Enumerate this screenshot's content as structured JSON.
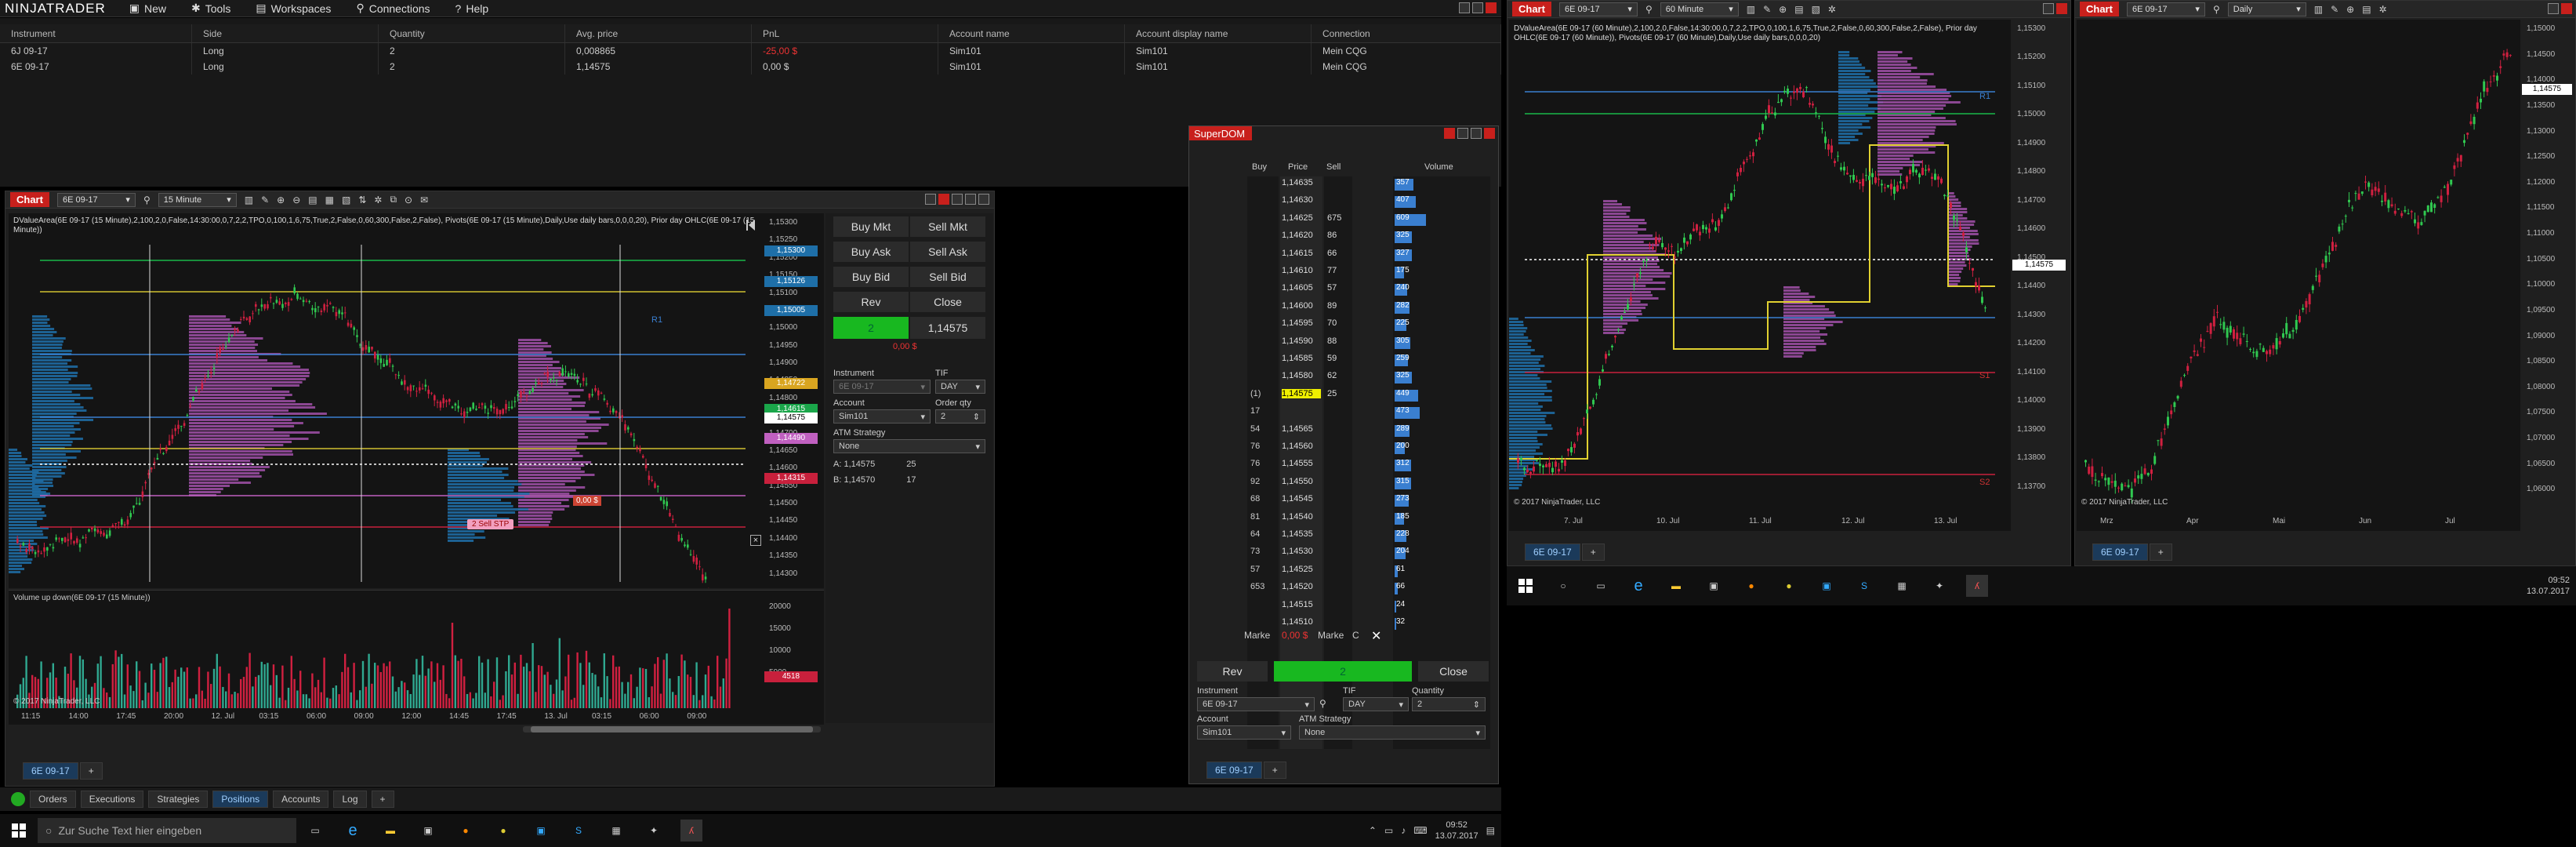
{
  "app": {
    "logo": "NINJATRADER",
    "menu": [
      "New",
      "Tools",
      "Workspaces",
      "Connections",
      "Help"
    ]
  },
  "positions": {
    "columns": [
      "Instrument",
      "Side",
      "Quantity",
      "Avg. price",
      "PnL",
      "Account name",
      "Account display name",
      "Connection"
    ],
    "rows": [
      [
        "6J 09-17",
        "Long",
        "2",
        "0,008865",
        "-25,00 $",
        "Sim101",
        "Sim101",
        "Mein CQG"
      ],
      [
        "6E 09-17",
        "Long",
        "2",
        "1,14575",
        "0,00 $",
        "Sim101",
        "Sim101",
        "Mein CQG"
      ]
    ]
  },
  "chart1": {
    "title": "Chart",
    "instrument": "6E 09-17",
    "interval": "15 Minute",
    "indicator_text": "DValueArea(6E 09-17 (15 Minute),2,100,2,0,False,14:30:00,0,7,2,2,TPO,0,100,1,6,75,True,2,False,0,60,300,False,2,False), Pivots(6E 09-17 (15 Minute),Daily,Use daily bars,0,0,0,20), Prior day OHLC(6E 09-17 (15 Minute))",
    "volume_label": "Volume up down(6E 09-17 (15 Minute))",
    "copyright": "© 2017 NinjaTrader, LLC",
    "price_ticks": [
      "1,15300",
      "1,15250",
      "1,15200",
      "1,15150",
      "1,15100",
      "1,15050",
      "1,15000",
      "1,14950",
      "1,14900",
      "1,14850",
      "1,14800",
      "1,14750",
      "1,14700",
      "1,14650",
      "1,14600",
      "1,14550",
      "1,14500",
      "1,14450",
      "1,14400",
      "1,14350",
      "1,14300"
    ],
    "price_boxes": [
      {
        "text": "1,15300",
        "color": "#1e6fa8"
      },
      {
        "text": "1,15126",
        "color": "#1e6fa8"
      },
      {
        "text": "1,15005",
        "color": "#1e6fa8"
      },
      {
        "text": "1,14722",
        "color": "#d9a520"
      },
      {
        "text": "1,14615",
        "color": "#1aa64a"
      },
      {
        "text": "1,14575",
        "color": "#ffffff"
      },
      {
        "text": "1,14490",
        "color": "#c060c0"
      },
      {
        "text": "1,14315",
        "color": "#c8203c"
      }
    ],
    "vol_ticks": [
      "20000",
      "15000",
      "10000",
      "5000"
    ],
    "vol_box": "4518",
    "time_ticks": [
      "11:15",
      "14:00",
      "17:45",
      "20:00",
      "12. Jul",
      "03:15",
      "06:00",
      "09:00",
      "12:00",
      "14:45",
      "17:45",
      "13. Jul",
      "03:15",
      "06:00",
      "09:00"
    ],
    "r1": "R1",
    "order_marker": "2 Sell STP",
    "order_marker2": "0,00 $",
    "chart_trader": {
      "buy_mkt": "Buy Mkt",
      "sell_mkt": "Sell Mkt",
      "buy_ask": "Buy Ask",
      "sell_ask": "Sell Ask",
      "buy_bid": "Buy Bid",
      "sell_bid": "Sell Bid",
      "rev": "Rev",
      "close": "Close",
      "position_qty": "2",
      "position_price": "1,14575",
      "pnl": "0,00 $",
      "instrument_label": "Instrument",
      "instrument_value": "6E 09-17",
      "tif_label": "TIF",
      "tif_value": "DAY",
      "account_label": "Account",
      "account_value": "Sim101",
      "orderqty_label": "Order qty",
      "orderqty_value": "2",
      "atm_label": "ATM Strategy",
      "atm_value": "None",
      "ask_label": "A:",
      "ask_price": "1,14575",
      "ask_size": "25",
      "bid_label": "B:",
      "bid_price": "1,14570",
      "bid_size": "17"
    },
    "tab": "6E 09-17"
  },
  "superdom": {
    "title": "SuperDOM",
    "headers": {
      "buy": "Buy",
      "price": "Price",
      "sell": "Sell",
      "volume": "Volume"
    },
    "rows": [
      {
        "buy": "",
        "price": "1,14635",
        "sell": "",
        "vol": "357"
      },
      {
        "buy": "",
        "price": "1,14630",
        "sell": "",
        "vol": "407"
      },
      {
        "buy": "",
        "price": "1,14625",
        "sell": "675",
        "vol": "609"
      },
      {
        "buy": "",
        "price": "1,14620",
        "sell": "86",
        "vol": "325"
      },
      {
        "buy": "",
        "price": "1,14615",
        "sell": "66",
        "vol": "327"
      },
      {
        "buy": "",
        "price": "1,14610",
        "sell": "77",
        "vol": "175"
      },
      {
        "buy": "",
        "price": "1,14605",
        "sell": "57",
        "vol": "240"
      },
      {
        "buy": "",
        "price": "1,14600",
        "sell": "89",
        "vol": "282"
      },
      {
        "buy": "",
        "price": "1,14595",
        "sell": "70",
        "vol": "225"
      },
      {
        "buy": "",
        "price": "1,14590",
        "sell": "88",
        "vol": "305"
      },
      {
        "buy": "",
        "price": "1,14585",
        "sell": "59",
        "vol": "259"
      },
      {
        "buy": "",
        "price": "1,14580",
        "sell": "62",
        "vol": "325"
      },
      {
        "buy": "(1)",
        "price": "1,14575",
        "sell": "25",
        "vol": "449"
      },
      {
        "buy": "17",
        "price": "",
        "sell": "",
        "vol": "473"
      },
      {
        "buy": "54",
        "price": "1,14565",
        "sell": "",
        "vol": "289"
      },
      {
        "buy": "76",
        "price": "1,14560",
        "sell": "",
        "vol": "200"
      },
      {
        "buy": "76",
        "price": "1,14555",
        "sell": "",
        "vol": "312"
      },
      {
        "buy": "92",
        "price": "1,14550",
        "sell": "",
        "vol": "315"
      },
      {
        "buy": "68",
        "price": "1,14545",
        "sell": "",
        "vol": "273"
      },
      {
        "buy": "81",
        "price": "1,14540",
        "sell": "",
        "vol": "185"
      },
      {
        "buy": "64",
        "price": "1,14535",
        "sell": "",
        "vol": "228"
      },
      {
        "buy": "73",
        "price": "1,14530",
        "sell": "",
        "vol": "204"
      },
      {
        "buy": "57",
        "price": "1,14525",
        "sell": "",
        "vol": "61"
      },
      {
        "buy": "653",
        "price": "1,14520",
        "sell": "",
        "vol": "66"
      },
      {
        "buy": "",
        "price": "1,14515",
        "sell": "",
        "vol": "24"
      },
      {
        "buy": "",
        "price": "1,14510",
        "sell": "",
        "vol": "32"
      }
    ],
    "market_left": "Marke",
    "market_pnl": "0,00 $",
    "market_right": "Marke",
    "c": "C",
    "rev": "Rev",
    "qty": "2",
    "close": "Close",
    "instrument_label": "Instrument",
    "instrument_value": "6E 09-17",
    "tif_label": "TIF",
    "tif_value": "DAY",
    "quantity_label": "Quantity",
    "quantity_value": "2",
    "account_label": "Account",
    "account_value": "Sim101",
    "atm_label": "ATM Strategy",
    "atm_value": "None",
    "tab": "6E 09-17"
  },
  "bottom_tabs": [
    "Orders",
    "Executions",
    "Strategies",
    "Positions",
    "Accounts",
    "Log"
  ],
  "chart2": {
    "title": "Chart",
    "instrument": "6E 09-17",
    "interval": "60 Minute",
    "indicator_text": "DValueArea(6E 09-17 (60 Minute),2,100,2,0,False,14:30:00,0,7,2,2,TPO,0,100,1,6,75,True,2,False,0,60,300,False,2,False), Prior day OHLC(6E 09-17 (60 Minute)), Pivots(6E 09-17 (60 Minute),Daily,Use daily bars,0,0,0,20)",
    "copyright": "© 2017 NinjaTrader, LLC",
    "price_ticks": [
      "1,15300",
      "1,15200",
      "1,15100",
      "1,15000",
      "1,14900",
      "1,14800",
      "1,14700",
      "1,14600",
      "1,14500",
      "1,14400",
      "1,14300",
      "1,14200",
      "1,14100",
      "1,14000",
      "1,13900",
      "1,13800",
      "1,13700"
    ],
    "current": "1,14575",
    "time_ticks": [
      "7. Jul",
      "10. Jul",
      "11. Jul",
      "12. Jul",
      "13. Jul"
    ],
    "labels": [
      "R1",
      "S1",
      "S2"
    ],
    "tab": "6E 09-17"
  },
  "chart3": {
    "title": "Chart",
    "instrument": "6E 09-17",
    "interval": "Daily",
    "copyright": "© 2017 NinjaTrader, LLC",
    "price_ticks": [
      "1,15000",
      "1,14500",
      "1,14000",
      "1,13500",
      "1,13000",
      "1,12500",
      "1,12000",
      "1,11500",
      "1,11000",
      "1,10500",
      "1,10000",
      "1,09500",
      "1,09000",
      "1,08500",
      "1,08000",
      "1,07500",
      "1,07000",
      "1,06500",
      "1,06000"
    ],
    "current": "1,14575",
    "time_ticks": [
      "Mrz",
      "Apr",
      "Mai",
      "Jun",
      "Jul"
    ],
    "tab": "6E 09-17"
  },
  "taskbar_left": {
    "search": "Zur Suche Text hier eingeben",
    "time": "09:52",
    "date": "13.07.2017"
  },
  "taskbar_right": {
    "time": "09:52",
    "date": "13.07.2017"
  }
}
